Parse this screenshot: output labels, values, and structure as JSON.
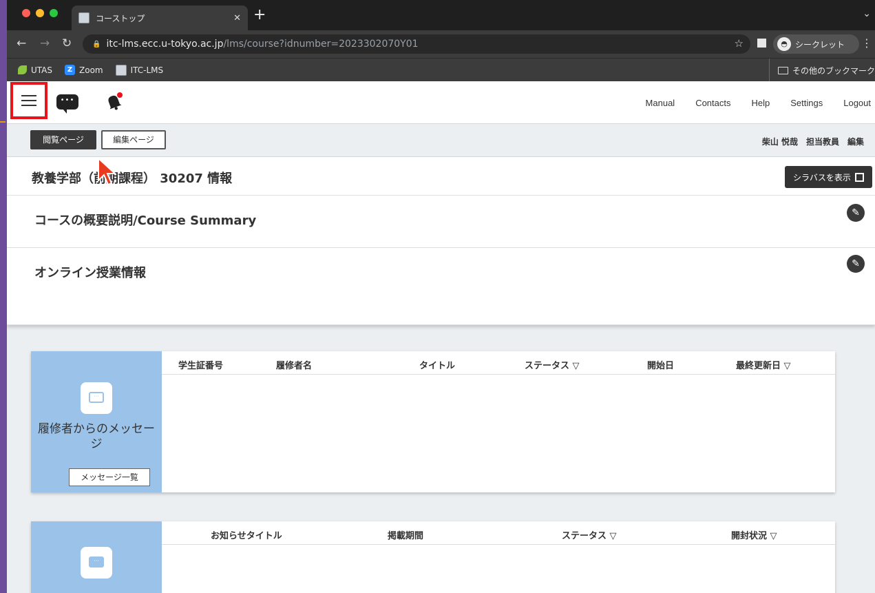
{
  "browser": {
    "tab_title": "コーストップ",
    "url_host": "itc-lms.ecc.u-tokyo.ac.jp",
    "url_path": "/lms/course?idnumber=2023302070Y01",
    "incognito_label": "シークレット",
    "bookmarks": [
      "UTAS",
      "Zoom",
      "ITC-LMS"
    ],
    "other_bookmarks": "その他のブックマーク"
  },
  "header": {
    "nav": [
      "Manual",
      "Contacts",
      "Help",
      "Settings",
      "Logout"
    ]
  },
  "subbar": {
    "view_page": "閲覧ページ",
    "edit_page": "編集ページ",
    "teacher": "柴山 悦哉　担当教員　編集"
  },
  "course": {
    "title": "教養学部（前期課程） 30207 情報",
    "syllabus_button": "シラバスを表示",
    "summary_title": "コースの概要説明/Course Summary",
    "online_title": "オンライン授業情報"
  },
  "messages_card": {
    "label": "履修者からのメッセージ",
    "button": "メッセージ一覧",
    "columns": [
      "学生証番号",
      "履修者名",
      "タイトル",
      "ステータス ▽",
      "開始日",
      "最終更新日 ▽"
    ]
  },
  "notice_card": {
    "columns": [
      "お知らせタイトル",
      "掲載期間",
      "ステータス ▽",
      "開封状況 ▽"
    ]
  },
  "colors": {
    "accent_red": "#e8131b",
    "card_side_blue": "#9bc3ea",
    "dark_button": "#333333"
  }
}
